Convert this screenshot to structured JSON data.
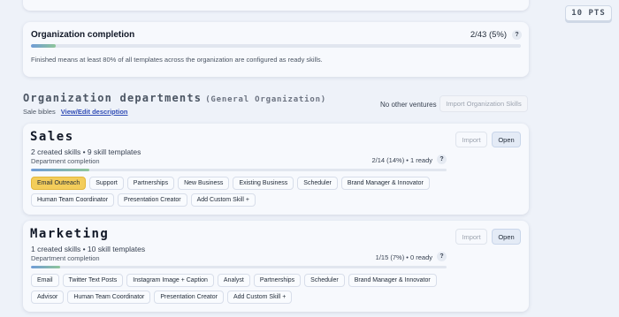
{
  "points_badge": "10 PTS",
  "org_completion": {
    "title": "Organization completion",
    "count": "2/43 (5%)",
    "progress": 0.05,
    "help": "?",
    "description": "Finished means at least 80% of all templates across the organization are configured as ready skills."
  },
  "departments_header": {
    "title": "Organization departments",
    "subtitle": "(General Organization)",
    "sale_bibles_label": "Sale bibles",
    "edit_link": "View/Edit description",
    "no_ventures": "No other ventures",
    "import_button": "Import Organization Skills"
  },
  "departments": [
    {
      "name": "Sales",
      "stats": "2 created skills • 9 skill templates",
      "completion_label": "Department completion",
      "completion_count": "2/14 (14%) • 1 ready",
      "progress": 0.14,
      "help": "?",
      "import_label": "Import",
      "open_label": "Open",
      "skills": [
        {
          "label": "Email Outreach",
          "active": true
        },
        {
          "label": "Support",
          "active": false
        },
        {
          "label": "Partnerships",
          "active": false
        },
        {
          "label": "New Business",
          "active": false
        },
        {
          "label": "Existing Business",
          "active": false
        },
        {
          "label": "Scheduler",
          "active": false
        },
        {
          "label": "Brand Manager & Innovator",
          "active": false
        },
        {
          "label": "Human Team Coordinator",
          "active": false
        },
        {
          "label": "Presentation Creator",
          "active": false
        },
        {
          "label": "Add Custom Skill +",
          "active": false
        }
      ]
    },
    {
      "name": "Marketing",
      "stats": "1 created skills • 10 skill templates",
      "completion_label": "Department completion",
      "completion_count": "1/15 (7%) • 0 ready",
      "progress": 0.07,
      "help": "?",
      "import_label": "Import",
      "open_label": "Open",
      "skills": [
        {
          "label": "Email",
          "active": false
        },
        {
          "label": "Twitter Text Posts",
          "active": false
        },
        {
          "label": "Instagram Image + Caption",
          "active": false
        },
        {
          "label": "Analyst",
          "active": false
        },
        {
          "label": "Partnerships",
          "active": false
        },
        {
          "label": "Scheduler",
          "active": false
        },
        {
          "label": "Brand Manager & Innovator",
          "active": false
        },
        {
          "label": "Advisor",
          "active": false
        },
        {
          "label": "Human Team Coordinator",
          "active": false
        },
        {
          "label": "Presentation Creator",
          "active": false
        },
        {
          "label": "Add Custom Skill +",
          "active": false
        }
      ]
    }
  ]
}
